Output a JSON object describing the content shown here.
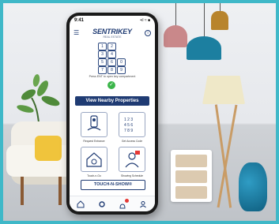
{
  "status_bar": {
    "time": "9:41",
    "signal": "•ıl ≈ ■"
  },
  "app": {
    "brand": "SENTRIKEY",
    "brand_sub": "REAL ESTATE"
  },
  "keypad": {
    "keys": [
      "1",
      "2",
      "3",
      "4",
      "5",
      "6",
      "7",
      "8",
      "9",
      "0"
    ]
  },
  "message": "Press ENT to open key compartment",
  "buttons": {
    "view_nearby": "View Nearby Properties",
    "touch_n_show": "TOUCH-N-SHOW®"
  },
  "tiles": [
    {
      "label": "Request Entrance"
    },
    {
      "label": "Get Access Code"
    },
    {
      "label": "Touch-n-Go"
    },
    {
      "label": "Showing Schedule"
    }
  ],
  "colors": {
    "navy": "#1f3b73",
    "success": "#3bb54a",
    "frame": "#3fb8c8",
    "alert": "#e53935"
  }
}
